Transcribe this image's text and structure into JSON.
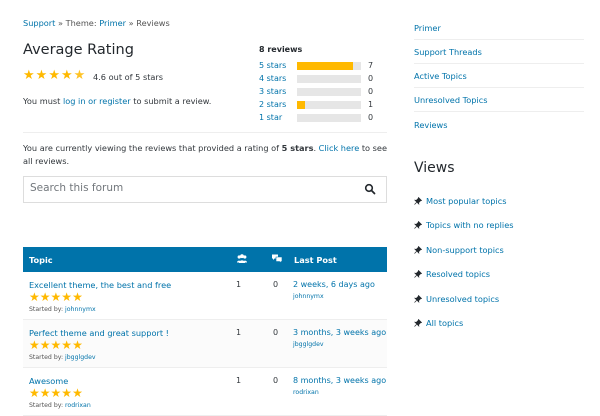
{
  "breadcrumb": {
    "support": "Support",
    "sep1": " » Theme: ",
    "theme": "Primer",
    "sep2": " » Reviews"
  },
  "rating": {
    "title": "Average Rating",
    "stars": 4.6,
    "text": "4.6 out of 5 stars",
    "login_prefix": "You must ",
    "login_link": "log in or register",
    "login_suffix": " to submit a review."
  },
  "counts": {
    "title": "8 reviews",
    "rows": [
      {
        "label": "5 stars",
        "count": "7",
        "fraction": 0.875
      },
      {
        "label": "4 stars",
        "count": "0",
        "fraction": 0
      },
      {
        "label": "3 stars",
        "count": "0",
        "fraction": 0
      },
      {
        "label": "2 stars",
        "count": "1",
        "fraction": 0.125
      },
      {
        "label": "1 star",
        "count": "0",
        "fraction": 0
      }
    ]
  },
  "filter": {
    "prefix": "You are currently viewing the reviews that provided a rating of ",
    "bold": "5 stars",
    "middle": ". ",
    "link": "Click here",
    "suffix": " to see all reviews."
  },
  "search": {
    "placeholder": "Search this forum",
    "icon": "search-icon"
  },
  "table": {
    "header_topic": "Topic",
    "header_voices_icon": "users-icon",
    "header_posts_icon": "comments-icon",
    "header_last": "Last Post",
    "rows": [
      {
        "title": "Excellent theme, the best and free",
        "stars": 5,
        "started_prefix": "Started by: ",
        "started_by": "johnnymx",
        "voices": "1",
        "posts": "0",
        "freshness": "2 weeks, 6 days ago",
        "author": "johnnymx"
      },
      {
        "title": "Perfect theme and great support !",
        "stars": 5,
        "started_prefix": "Started by: ",
        "started_by": "jbgglgdev",
        "voices": "1",
        "posts": "0",
        "freshness": "3 months, 3 weeks ago",
        "author": "jbgglgdev"
      },
      {
        "title": "Awesome",
        "stars": 5,
        "started_prefix": "Started by: ",
        "started_by": "rodrixan",
        "voices": "1",
        "posts": "0",
        "freshness": "8 months, 3 weeks ago",
        "author": "rodrixan"
      }
    ]
  },
  "sidebar": {
    "links": [
      "Primer",
      "Support Threads",
      "Active Topics",
      "Unresolved Topics",
      "Reviews"
    ],
    "views_title": "Views",
    "views": [
      "Most popular topics",
      "Topics with no replies",
      "Non-support topics",
      "Resolved topics",
      "Unresolved topics",
      "All topics"
    ]
  },
  "colors": {
    "link": "#0073aa",
    "star": "#ffb900",
    "header_bg": "#0073aa"
  }
}
